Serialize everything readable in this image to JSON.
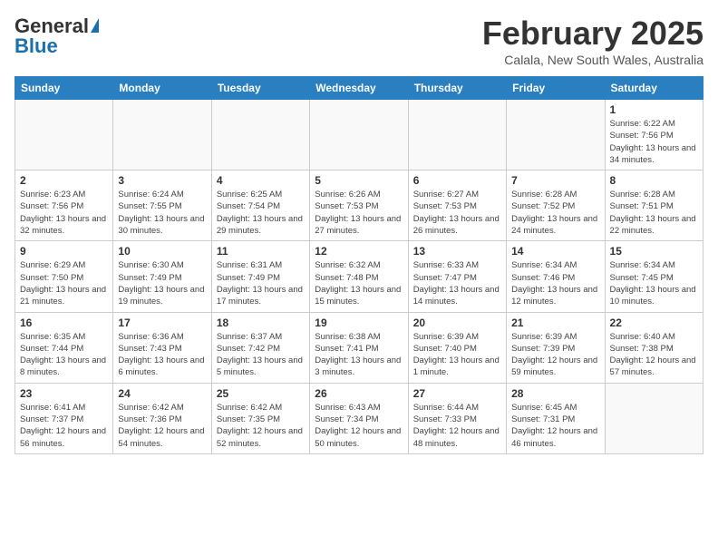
{
  "header": {
    "logo_line1": "General",
    "logo_line2": "Blue",
    "month_year": "February 2025",
    "location": "Calala, New South Wales, Australia"
  },
  "weekdays": [
    "Sunday",
    "Monday",
    "Tuesday",
    "Wednesday",
    "Thursday",
    "Friday",
    "Saturday"
  ],
  "weeks": [
    [
      {
        "day": "",
        "info": ""
      },
      {
        "day": "",
        "info": ""
      },
      {
        "day": "",
        "info": ""
      },
      {
        "day": "",
        "info": ""
      },
      {
        "day": "",
        "info": ""
      },
      {
        "day": "",
        "info": ""
      },
      {
        "day": "1",
        "info": "Sunrise: 6:22 AM\nSunset: 7:56 PM\nDaylight: 13 hours and 34 minutes."
      }
    ],
    [
      {
        "day": "2",
        "info": "Sunrise: 6:23 AM\nSunset: 7:56 PM\nDaylight: 13 hours and 32 minutes."
      },
      {
        "day": "3",
        "info": "Sunrise: 6:24 AM\nSunset: 7:55 PM\nDaylight: 13 hours and 30 minutes."
      },
      {
        "day": "4",
        "info": "Sunrise: 6:25 AM\nSunset: 7:54 PM\nDaylight: 13 hours and 29 minutes."
      },
      {
        "day": "5",
        "info": "Sunrise: 6:26 AM\nSunset: 7:53 PM\nDaylight: 13 hours and 27 minutes."
      },
      {
        "day": "6",
        "info": "Sunrise: 6:27 AM\nSunset: 7:53 PM\nDaylight: 13 hours and 26 minutes."
      },
      {
        "day": "7",
        "info": "Sunrise: 6:28 AM\nSunset: 7:52 PM\nDaylight: 13 hours and 24 minutes."
      },
      {
        "day": "8",
        "info": "Sunrise: 6:28 AM\nSunset: 7:51 PM\nDaylight: 13 hours and 22 minutes."
      }
    ],
    [
      {
        "day": "9",
        "info": "Sunrise: 6:29 AM\nSunset: 7:50 PM\nDaylight: 13 hours and 21 minutes."
      },
      {
        "day": "10",
        "info": "Sunrise: 6:30 AM\nSunset: 7:49 PM\nDaylight: 13 hours and 19 minutes."
      },
      {
        "day": "11",
        "info": "Sunrise: 6:31 AM\nSunset: 7:49 PM\nDaylight: 13 hours and 17 minutes."
      },
      {
        "day": "12",
        "info": "Sunrise: 6:32 AM\nSunset: 7:48 PM\nDaylight: 13 hours and 15 minutes."
      },
      {
        "day": "13",
        "info": "Sunrise: 6:33 AM\nSunset: 7:47 PM\nDaylight: 13 hours and 14 minutes."
      },
      {
        "day": "14",
        "info": "Sunrise: 6:34 AM\nSunset: 7:46 PM\nDaylight: 13 hours and 12 minutes."
      },
      {
        "day": "15",
        "info": "Sunrise: 6:34 AM\nSunset: 7:45 PM\nDaylight: 13 hours and 10 minutes."
      }
    ],
    [
      {
        "day": "16",
        "info": "Sunrise: 6:35 AM\nSunset: 7:44 PM\nDaylight: 13 hours and 8 minutes."
      },
      {
        "day": "17",
        "info": "Sunrise: 6:36 AM\nSunset: 7:43 PM\nDaylight: 13 hours and 6 minutes."
      },
      {
        "day": "18",
        "info": "Sunrise: 6:37 AM\nSunset: 7:42 PM\nDaylight: 13 hours and 5 minutes."
      },
      {
        "day": "19",
        "info": "Sunrise: 6:38 AM\nSunset: 7:41 PM\nDaylight: 13 hours and 3 minutes."
      },
      {
        "day": "20",
        "info": "Sunrise: 6:39 AM\nSunset: 7:40 PM\nDaylight: 13 hours and 1 minute."
      },
      {
        "day": "21",
        "info": "Sunrise: 6:39 AM\nSunset: 7:39 PM\nDaylight: 12 hours and 59 minutes."
      },
      {
        "day": "22",
        "info": "Sunrise: 6:40 AM\nSunset: 7:38 PM\nDaylight: 12 hours and 57 minutes."
      }
    ],
    [
      {
        "day": "23",
        "info": "Sunrise: 6:41 AM\nSunset: 7:37 PM\nDaylight: 12 hours and 56 minutes."
      },
      {
        "day": "24",
        "info": "Sunrise: 6:42 AM\nSunset: 7:36 PM\nDaylight: 12 hours and 54 minutes."
      },
      {
        "day": "25",
        "info": "Sunrise: 6:42 AM\nSunset: 7:35 PM\nDaylight: 12 hours and 52 minutes."
      },
      {
        "day": "26",
        "info": "Sunrise: 6:43 AM\nSunset: 7:34 PM\nDaylight: 12 hours and 50 minutes."
      },
      {
        "day": "27",
        "info": "Sunrise: 6:44 AM\nSunset: 7:33 PM\nDaylight: 12 hours and 48 minutes."
      },
      {
        "day": "28",
        "info": "Sunrise: 6:45 AM\nSunset: 7:31 PM\nDaylight: 12 hours and 46 minutes."
      },
      {
        "day": "",
        "info": ""
      }
    ]
  ]
}
